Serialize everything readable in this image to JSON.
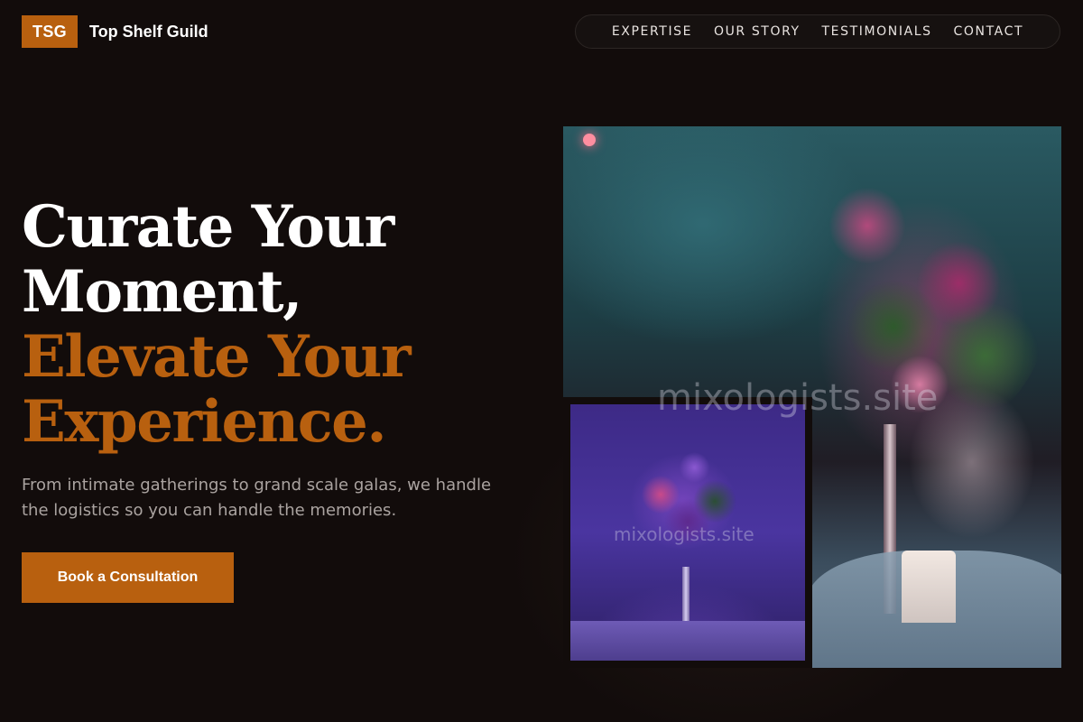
{
  "header": {
    "logo_badge": "TSG",
    "brand_name": "Top Shelf Guild"
  },
  "nav": {
    "items": [
      {
        "label": "EXPERTISE"
      },
      {
        "label": "OUR STORY"
      },
      {
        "label": "TESTIMONIALS"
      },
      {
        "label": "CONTACT"
      }
    ]
  },
  "hero": {
    "headline_line1": "Curate Your",
    "headline_line2": "Moment,",
    "headline_accent_line1": "Elevate Your",
    "headline_accent_line2": "Experience.",
    "subtitle": "From intimate gatherings to grand scale galas, we handle the logistics so you can handle the memories.",
    "cta_label": "Book a Consultation"
  },
  "images": {
    "watermark_text": "mixologists.site"
  },
  "colors": {
    "accent": "#b8600f",
    "background": "#120c0b",
    "subtitle_text": "#aaa3a0"
  }
}
